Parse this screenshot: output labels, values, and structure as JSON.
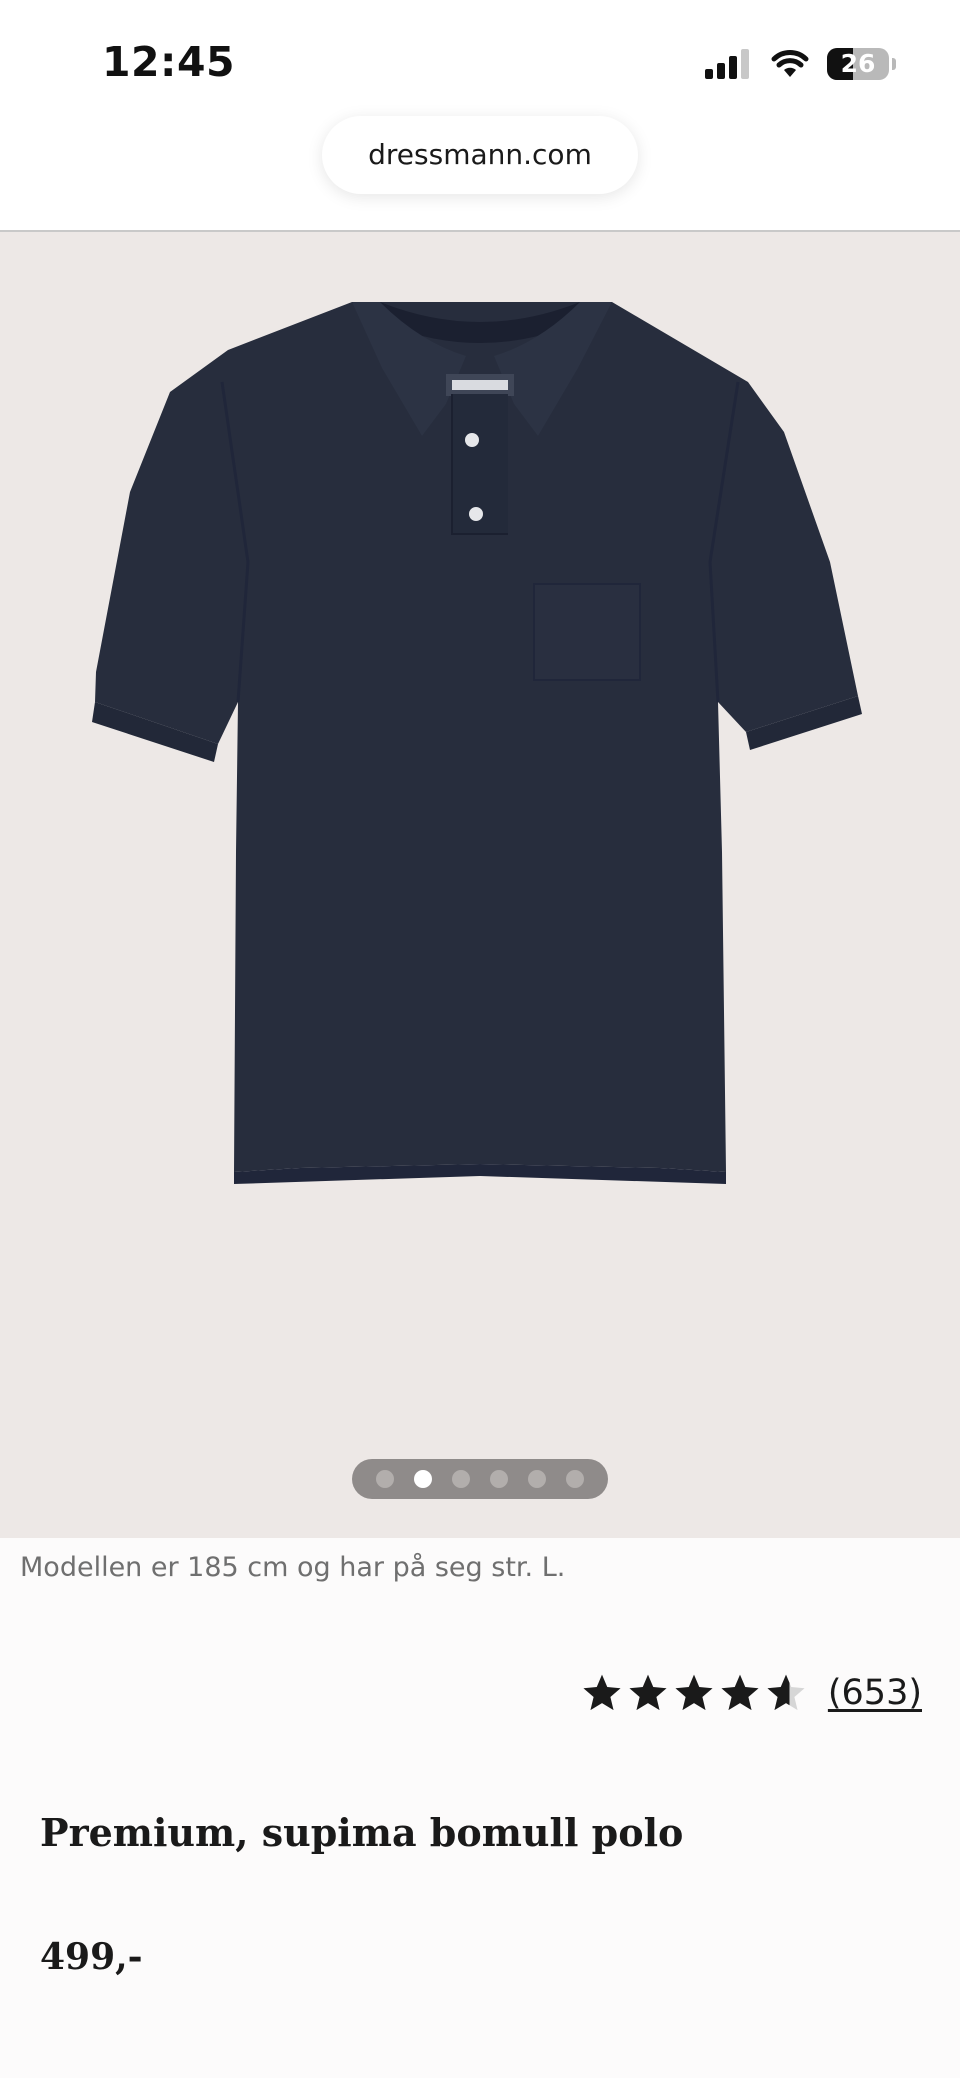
{
  "status_bar": {
    "time": "12:45",
    "battery_level": "26",
    "icons": [
      "signal-icon",
      "wifi-icon",
      "battery-icon"
    ]
  },
  "browser": {
    "url": "dressmann.com"
  },
  "gallery": {
    "image": "navy-polo-shirt-icon",
    "dot_count": 6,
    "active_dot": 2
  },
  "product": {
    "model_note": "Modellen er 185 cm og har på seg str. L.",
    "rating_stars": 4.5,
    "review_count": "(653)",
    "title": "Premium, supima bomull polo",
    "price": "499,-"
  },
  "colors": {
    "gallery_background": "#ede8e6",
    "shirt_navy": "#272d3d",
    "text": "#1a1a1a"
  }
}
